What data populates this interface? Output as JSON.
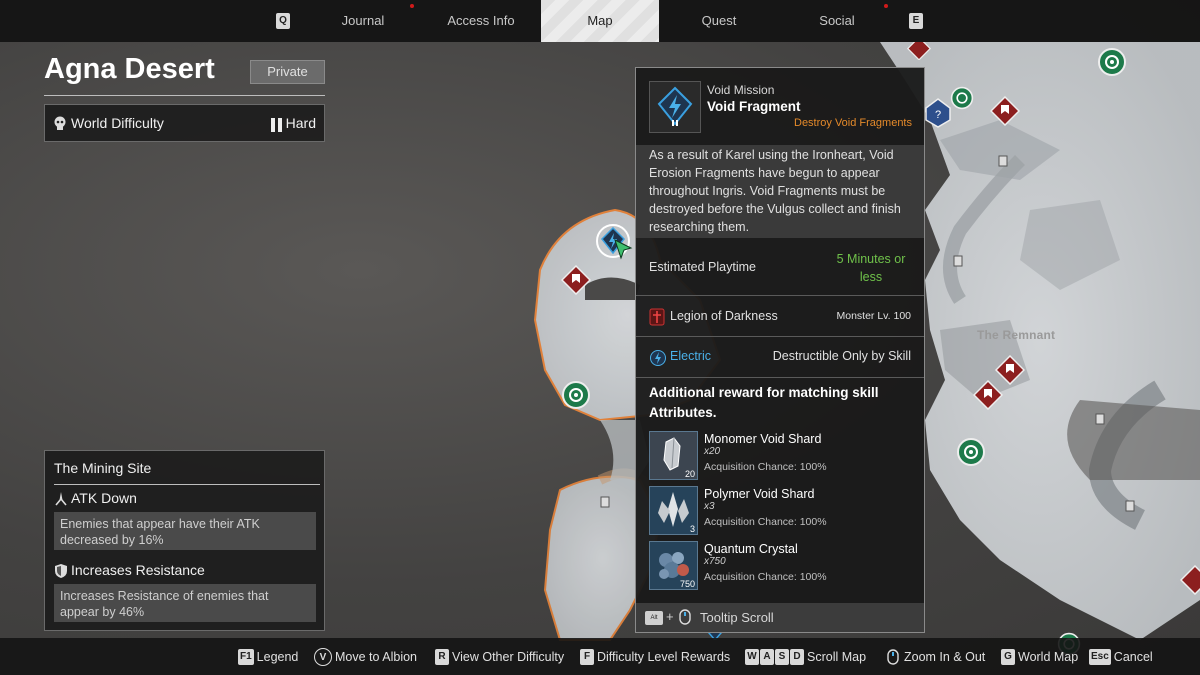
{
  "nav": {
    "key_left": "Q",
    "key_right": "E",
    "tabs": [
      {
        "label": "Journal"
      },
      {
        "label": "Access Info"
      },
      {
        "label": "Map"
      },
      {
        "label": "Quest"
      },
      {
        "label": "Social"
      }
    ],
    "active_tab": "Map"
  },
  "region": {
    "title": "Agna Desert",
    "privacy_button": "Private",
    "difficulty_label": "World Difficulty",
    "difficulty_value": "Hard"
  },
  "site": {
    "title": "The Mining Site",
    "effects": [
      {
        "name": "ATK Down",
        "icon": "sword-down-icon",
        "description": "Enemies that appear have their ATK decreased by 16%"
      },
      {
        "name": "Increases Resistance",
        "icon": "shield-icon",
        "description": "Increases Resistance of enemies that appear by 46%"
      }
    ]
  },
  "map": {
    "labels": {
      "remnant": "The Remnant"
    }
  },
  "tooltip": {
    "type": "Void Mission",
    "name": "Void Fragment",
    "objective": "Destroy Void Fragments",
    "description": "As a result of Karel using the Ironheart, Void Erosion Fragments have begun to appear throughout Ingris. Void Fragments must be destroyed before the Vulgus collect and finish researching them.",
    "playtime_label": "Estimated Playtime",
    "playtime_value": "5 Minutes or less",
    "faction": "Legion of Darkness",
    "monster_level": "Monster Lv. 100",
    "element": "Electric",
    "element_note": "Destructible Only by Skill",
    "bonus_title": "Additional reward for matching skill Attributes.",
    "rewards": [
      {
        "name": "Monomer Void Shard",
        "amount": "x20",
        "badge": "20",
        "chance": "Acquisition Chance: 100%"
      },
      {
        "name": "Polymer Void Shard",
        "amount": "x3",
        "badge": "3",
        "chance": "Acquisition Chance: 100%"
      },
      {
        "name": "Quantum Crystal",
        "amount": "x750",
        "badge": "750",
        "chance": "Acquisition Chance: 100%"
      }
    ],
    "footer_key": "Alt",
    "footer_plus": "+",
    "footer_label": "Tooltip Scroll"
  },
  "hints": [
    {
      "key": "F1",
      "label": "Legend"
    },
    {
      "key": "V",
      "label": "Move to Albion"
    },
    {
      "key": "R",
      "label": "View Other Difficulty"
    },
    {
      "key": "F",
      "label": "Difficulty Level Rewards"
    },
    {
      "keys": [
        "W",
        "A",
        "S",
        "D"
      ],
      "label": "Scroll Map"
    },
    {
      "key": "mouse-scroll-icon",
      "label": "Zoom In & Out"
    },
    {
      "key": "G",
      "label": "World Map"
    },
    {
      "key": "Esc",
      "label": "Cancel"
    }
  ],
  "colors": {
    "accent_orange": "#e58a2a",
    "time_green": "#6fc04a",
    "electric_blue": "#4ab0e8",
    "danger_red": "#8c1f1f"
  }
}
